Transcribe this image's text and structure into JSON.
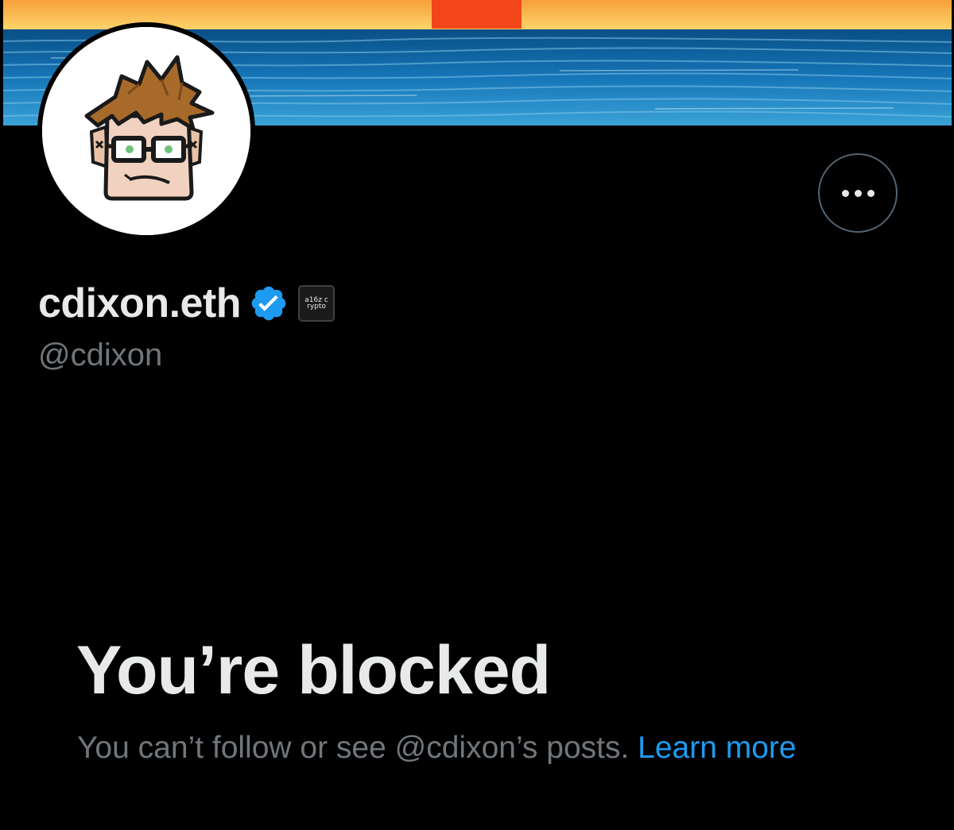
{
  "colors": {
    "background": "#000000",
    "primary_text": "#e7e9ea",
    "secondary_text": "#71767b",
    "link": "#1d9bf0",
    "verified_badge": "#1d9bf0",
    "button_border": "#536471"
  },
  "header": {
    "banner_icon": "sunset-over-ocean-banner",
    "avatar_icon": "cartoon-man-with-glasses-avatar",
    "more_button_icon": "more-horizontal-icon"
  },
  "profile": {
    "display_name": "cdixon.eth",
    "verified_icon": "verified-badge-icon",
    "affiliate_badge_text": "a16z crypto",
    "handle": "@cdixon"
  },
  "blocked": {
    "title": "You’re blocked",
    "message": "You can’t follow or see @cdixon’s posts.",
    "learn_more": "Learn more"
  }
}
